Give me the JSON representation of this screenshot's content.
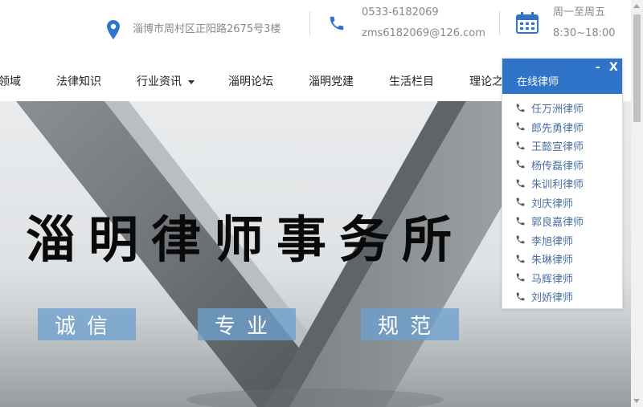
{
  "header": {
    "address": "淄博市周村区正阳路2675号3楼",
    "phone": "0533-6182069",
    "email": "zms6182069@126.com",
    "days": "周一至周五",
    "hours": "8:30~18:00",
    "icons": {
      "address": "location-pin-icon",
      "phone": "phone-icon",
      "hours": "calendar-icon"
    },
    "accent_color": "#2f74c9"
  },
  "nav": {
    "items": [
      {
        "label": "领域"
      },
      {
        "label": "法律知识"
      },
      {
        "label": "行业资讯"
      },
      {
        "label": "淄明论坛"
      },
      {
        "label": "淄明党建"
      },
      {
        "label": "生活栏目"
      },
      {
        "label": "理论之窗"
      }
    ]
  },
  "hero": {
    "title": "淄明律师事务所",
    "tags": [
      "诚信",
      "专业",
      "规范"
    ]
  },
  "widget": {
    "title": "在线律师",
    "minimize_label": "-",
    "close_label": "X",
    "lawyers": [
      "任万洲律师",
      "郎先勇律师",
      "王懿宣律师",
      "杨传磊律师",
      "朱训利律师",
      "刘庆律师",
      "郭良嘉律师",
      "李旭律师",
      "朱琳律师",
      "马辉律师",
      "刘娇律师"
    ]
  }
}
